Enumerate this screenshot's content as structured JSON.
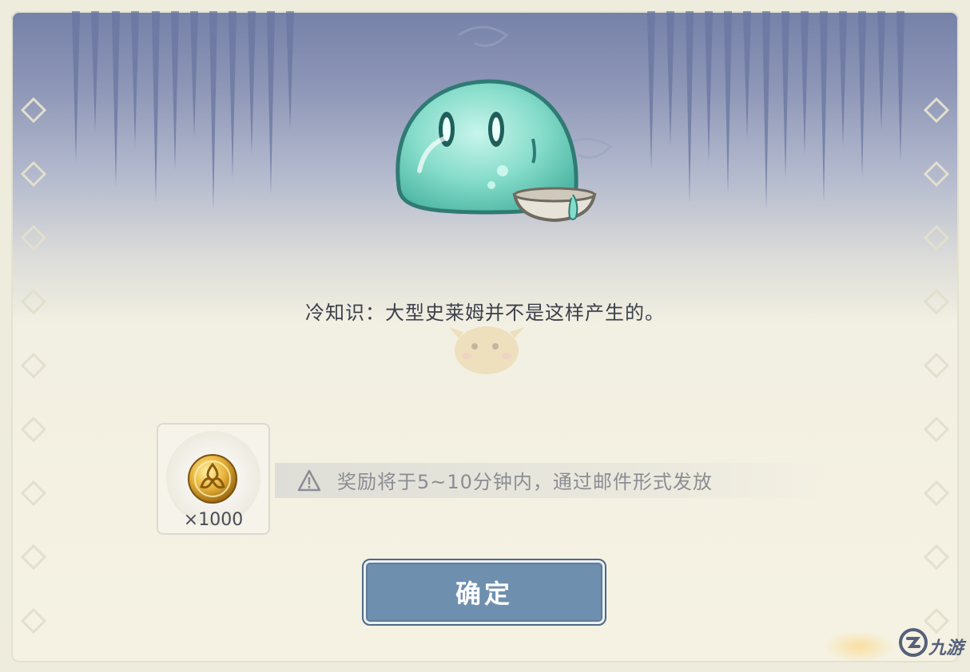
{
  "dialog": {
    "trivia_text": "冷知识：大型史莱姆并不是这样产生的。",
    "reward": {
      "icon": "mora-coin-icon",
      "quantity_label": "×1000"
    },
    "notice": {
      "icon": "warning-triangle-icon",
      "text": "奖励将于5~10分钟内，通过邮件形式发放"
    },
    "confirm_label": "确定"
  },
  "watermark": {
    "text": "九游"
  },
  "colors": {
    "button": "#6f8fae",
    "header_top": "#7681a9",
    "panel_bg": "#f5f2e3"
  }
}
